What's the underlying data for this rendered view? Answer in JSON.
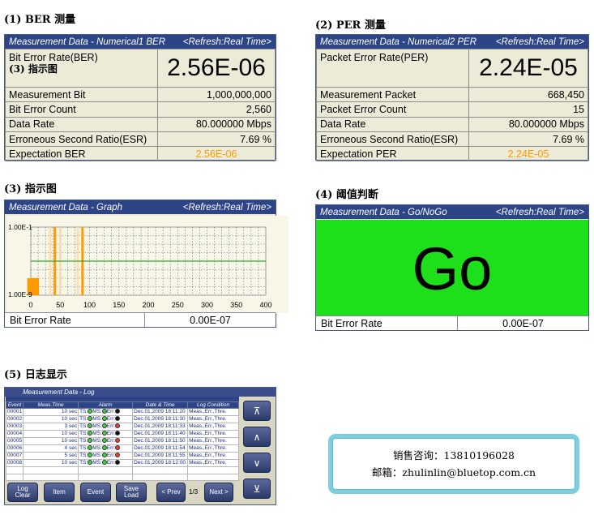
{
  "sections": {
    "ber": "(1) BER  测量",
    "per": "(2) PER  测量",
    "graph": "(3)  指示图",
    "gonogo": "(4)  阈值判断",
    "log": "(5)  日志显示"
  },
  "ber_panel": {
    "title": "Measurement Data - Numerical1 BER",
    "refresh": "<Refresh:Real Time>",
    "main_label": "Bit Error Rate(BER)",
    "overlay_label": "(3)  指示图",
    "main_value": "2.56E-06",
    "rows": [
      {
        "label": "Measurement Bit",
        "value": "1,000,000,000"
      },
      {
        "label": "Bit Error Count",
        "value": "2,560"
      },
      {
        "label": "Data Rate",
        "value": "80.000000 Mbps"
      },
      {
        "label": "Erroneous Second Ratio(ESR)",
        "value": "7.69 %"
      }
    ],
    "expectation": {
      "label": "Expectation BER",
      "value": "2.56E-06"
    }
  },
  "per_panel": {
    "title": "Measurement Data - Numerical2 PER",
    "refresh": "<Refresh:Real Time>",
    "main_label": "Packet Error Rate(PER)",
    "main_value": "2.24E-05",
    "rows": [
      {
        "label": "Measurement Packet",
        "value": "668,450"
      },
      {
        "label": "Packet Error Count",
        "value": "15"
      },
      {
        "label": "Data Rate",
        "value": "80.000000 Mbps"
      },
      {
        "label": "Erroneous Second Ratio(ESR)",
        "value": "7.69 %"
      }
    ],
    "expectation": {
      "label": "Expectation PER",
      "value": "2.24E-05"
    }
  },
  "graph_panel": {
    "title": "Measurement Data - Graph",
    "refresh": "<Refresh:Real Time>",
    "footer_label": "Bit Error Rate",
    "footer_value": "0.00E-07"
  },
  "gonogo_panel": {
    "title": "Measurement Data - Go/NoGo",
    "refresh": "<Refresh:Real Time>",
    "result": "Go",
    "footer_label": "Bit Error Rate",
    "footer_value": "0.00E-07"
  },
  "chart_data": {
    "type": "bar",
    "ytick_labels": [
      "1.00E-1",
      "1.00E-9"
    ],
    "xticks": [
      0,
      50,
      100,
      150,
      200,
      250,
      300,
      350,
      400
    ],
    "xlim": [
      0,
      400
    ],
    "y_scale": "log",
    "ylim": [
      1e-09,
      0.1
    ],
    "grid": true,
    "threshold_line": {
      "y": 1e-05,
      "color": "#2fa82f"
    },
    "bars": [
      {
        "x": 4,
        "width": 20,
        "y": 1e-07
      },
      {
        "x": 41,
        "width": 4,
        "y": 0.1
      },
      {
        "x": 88,
        "width": 4,
        "y": 0.1
      }
    ],
    "bar_color": "#ff9900",
    "faint_bars": [
      {
        "x": 33,
        "y": 0.1
      },
      {
        "x": 50,
        "y": 0.1
      },
      {
        "x": 80,
        "y": 0.1
      }
    ]
  },
  "log_panel": {
    "title": "Measurement Data - Log",
    "columns": [
      "Event",
      "Meas.Time",
      "Alarm",
      "Date & Time",
      "Log Condition"
    ],
    "rows": [
      {
        "event": "00001",
        "time": "10 sec",
        "alarm": [
          "g",
          "g",
          "b"
        ],
        "date": "Dec.01,2009 18:11:20",
        "cond": "Meas.,Err.,Thre."
      },
      {
        "event": "00002",
        "time": "10 sec",
        "alarm": [
          "g",
          "g",
          "b"
        ],
        "date": "Dec.01,2009 18:11:30",
        "cond": "Meas.,Err.,Thre."
      },
      {
        "event": "00003",
        "time": "3 sec",
        "alarm": [
          "g",
          "g",
          "r"
        ],
        "date": "Dec.01,2009 18:11:33",
        "cond": "Meas.,Err.,Thre."
      },
      {
        "event": "00004",
        "time": "10 sec",
        "alarm": [
          "g",
          "g",
          "b"
        ],
        "date": "Dec.01,2009 18:11:40",
        "cond": "Meas.,Err.,Thre."
      },
      {
        "event": "00005",
        "time": "10 sec",
        "alarm": [
          "g",
          "g",
          "r"
        ],
        "date": "Dec.01,2009 18:11:50",
        "cond": "Meas.,Err.,Thre."
      },
      {
        "event": "00006",
        "time": "4 sec",
        "alarm": [
          "g",
          "g",
          "r"
        ],
        "date": "Dec.01,2009 18:11:54",
        "cond": "Meas.,Err.,Thre."
      },
      {
        "event": "00007",
        "time": "5 sec",
        "alarm": [
          "g",
          "g",
          "r"
        ],
        "date": "Dec.01,2009 18:11:55",
        "cond": "Meas.,Err.,Thre."
      },
      {
        "event": "00008",
        "time": "10 sec",
        "alarm": [
          "g",
          "g",
          "b"
        ],
        "date": "Dec.01,2009 18:12:00",
        "cond": "Meas.,Err.,Thre."
      }
    ],
    "alarm_labels": [
      "TS:",
      "MS:",
      "Err:"
    ],
    "buttons": {
      "log_clear_1": "Log",
      "log_clear_2": "Clear",
      "item": "Item",
      "event": "Event",
      "save_load_1": "Save",
      "save_load_2": "Load",
      "prev": "< Prev",
      "page": "1/3",
      "next": "Next >"
    },
    "scroll_icons": [
      "page-top-icon",
      "scroll-up-icon",
      "scroll-down-icon",
      "page-bottom-icon"
    ]
  },
  "contact": {
    "line1": "销售咨询：13810196028",
    "line2": "邮箱：zhulinlin@bluetop.com.cn"
  },
  "colors": {
    "header_blue": "#2d4486",
    "panel_bg": "#ecebd8",
    "accent_orange": "#ff9900",
    "go_green": "#1de01b",
    "contact_border": "#7ccfe0"
  }
}
